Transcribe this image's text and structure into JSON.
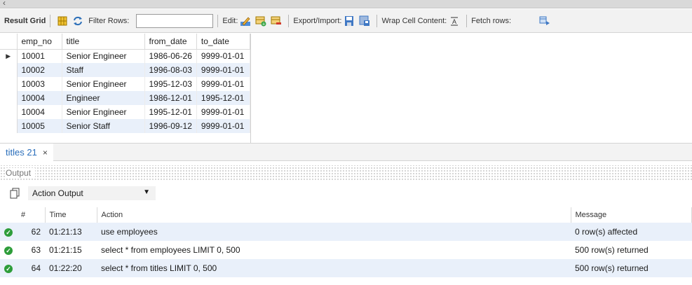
{
  "toolbar": {
    "result_grid_label": "Result Grid",
    "filter_rows_label": "Filter Rows:",
    "filter_rows_value": "",
    "edit_label": "Edit:",
    "export_import_label": "Export/Import:",
    "wrap_cell_label": "Wrap Cell Content:",
    "fetch_rows_label": "Fetch rows:"
  },
  "grid": {
    "columns": [
      "emp_no",
      "title",
      "from_date",
      "to_date"
    ],
    "rows": [
      [
        "10001",
        "Senior Engineer",
        "1986-06-26",
        "9999-01-01"
      ],
      [
        "10002",
        "Staff",
        "1996-08-03",
        "9999-01-01"
      ],
      [
        "10003",
        "Senior Engineer",
        "1995-12-03",
        "9999-01-01"
      ],
      [
        "10004",
        "Engineer",
        "1986-12-01",
        "1995-12-01"
      ],
      [
        "10004",
        "Senior Engineer",
        "1995-12-01",
        "9999-01-01"
      ],
      [
        "10005",
        "Senior Staff",
        "1996-09-12",
        "9999-01-01"
      ]
    ]
  },
  "result_tab": {
    "label": "titles 21",
    "close": "×"
  },
  "output": {
    "title": "Output",
    "selector_value": "Action Output",
    "columns": [
      "#",
      "Time",
      "Action",
      "Message"
    ],
    "rows": [
      {
        "num": "62",
        "time": "01:21:13",
        "action": "use employees",
        "message": "0 row(s) affected"
      },
      {
        "num": "63",
        "time": "01:21:15",
        "action": "select * from employees LIMIT 0, 500",
        "message": "500 row(s) returned"
      },
      {
        "num": "64",
        "time": "01:22:20",
        "action": "select * from titles LIMIT 0, 500",
        "message": "500 row(s) returned"
      }
    ]
  },
  "colors": {
    "row_alt": "#e9f0fa",
    "ok_green": "#2e9d3a",
    "tab_blue": "#2a6ebb"
  }
}
